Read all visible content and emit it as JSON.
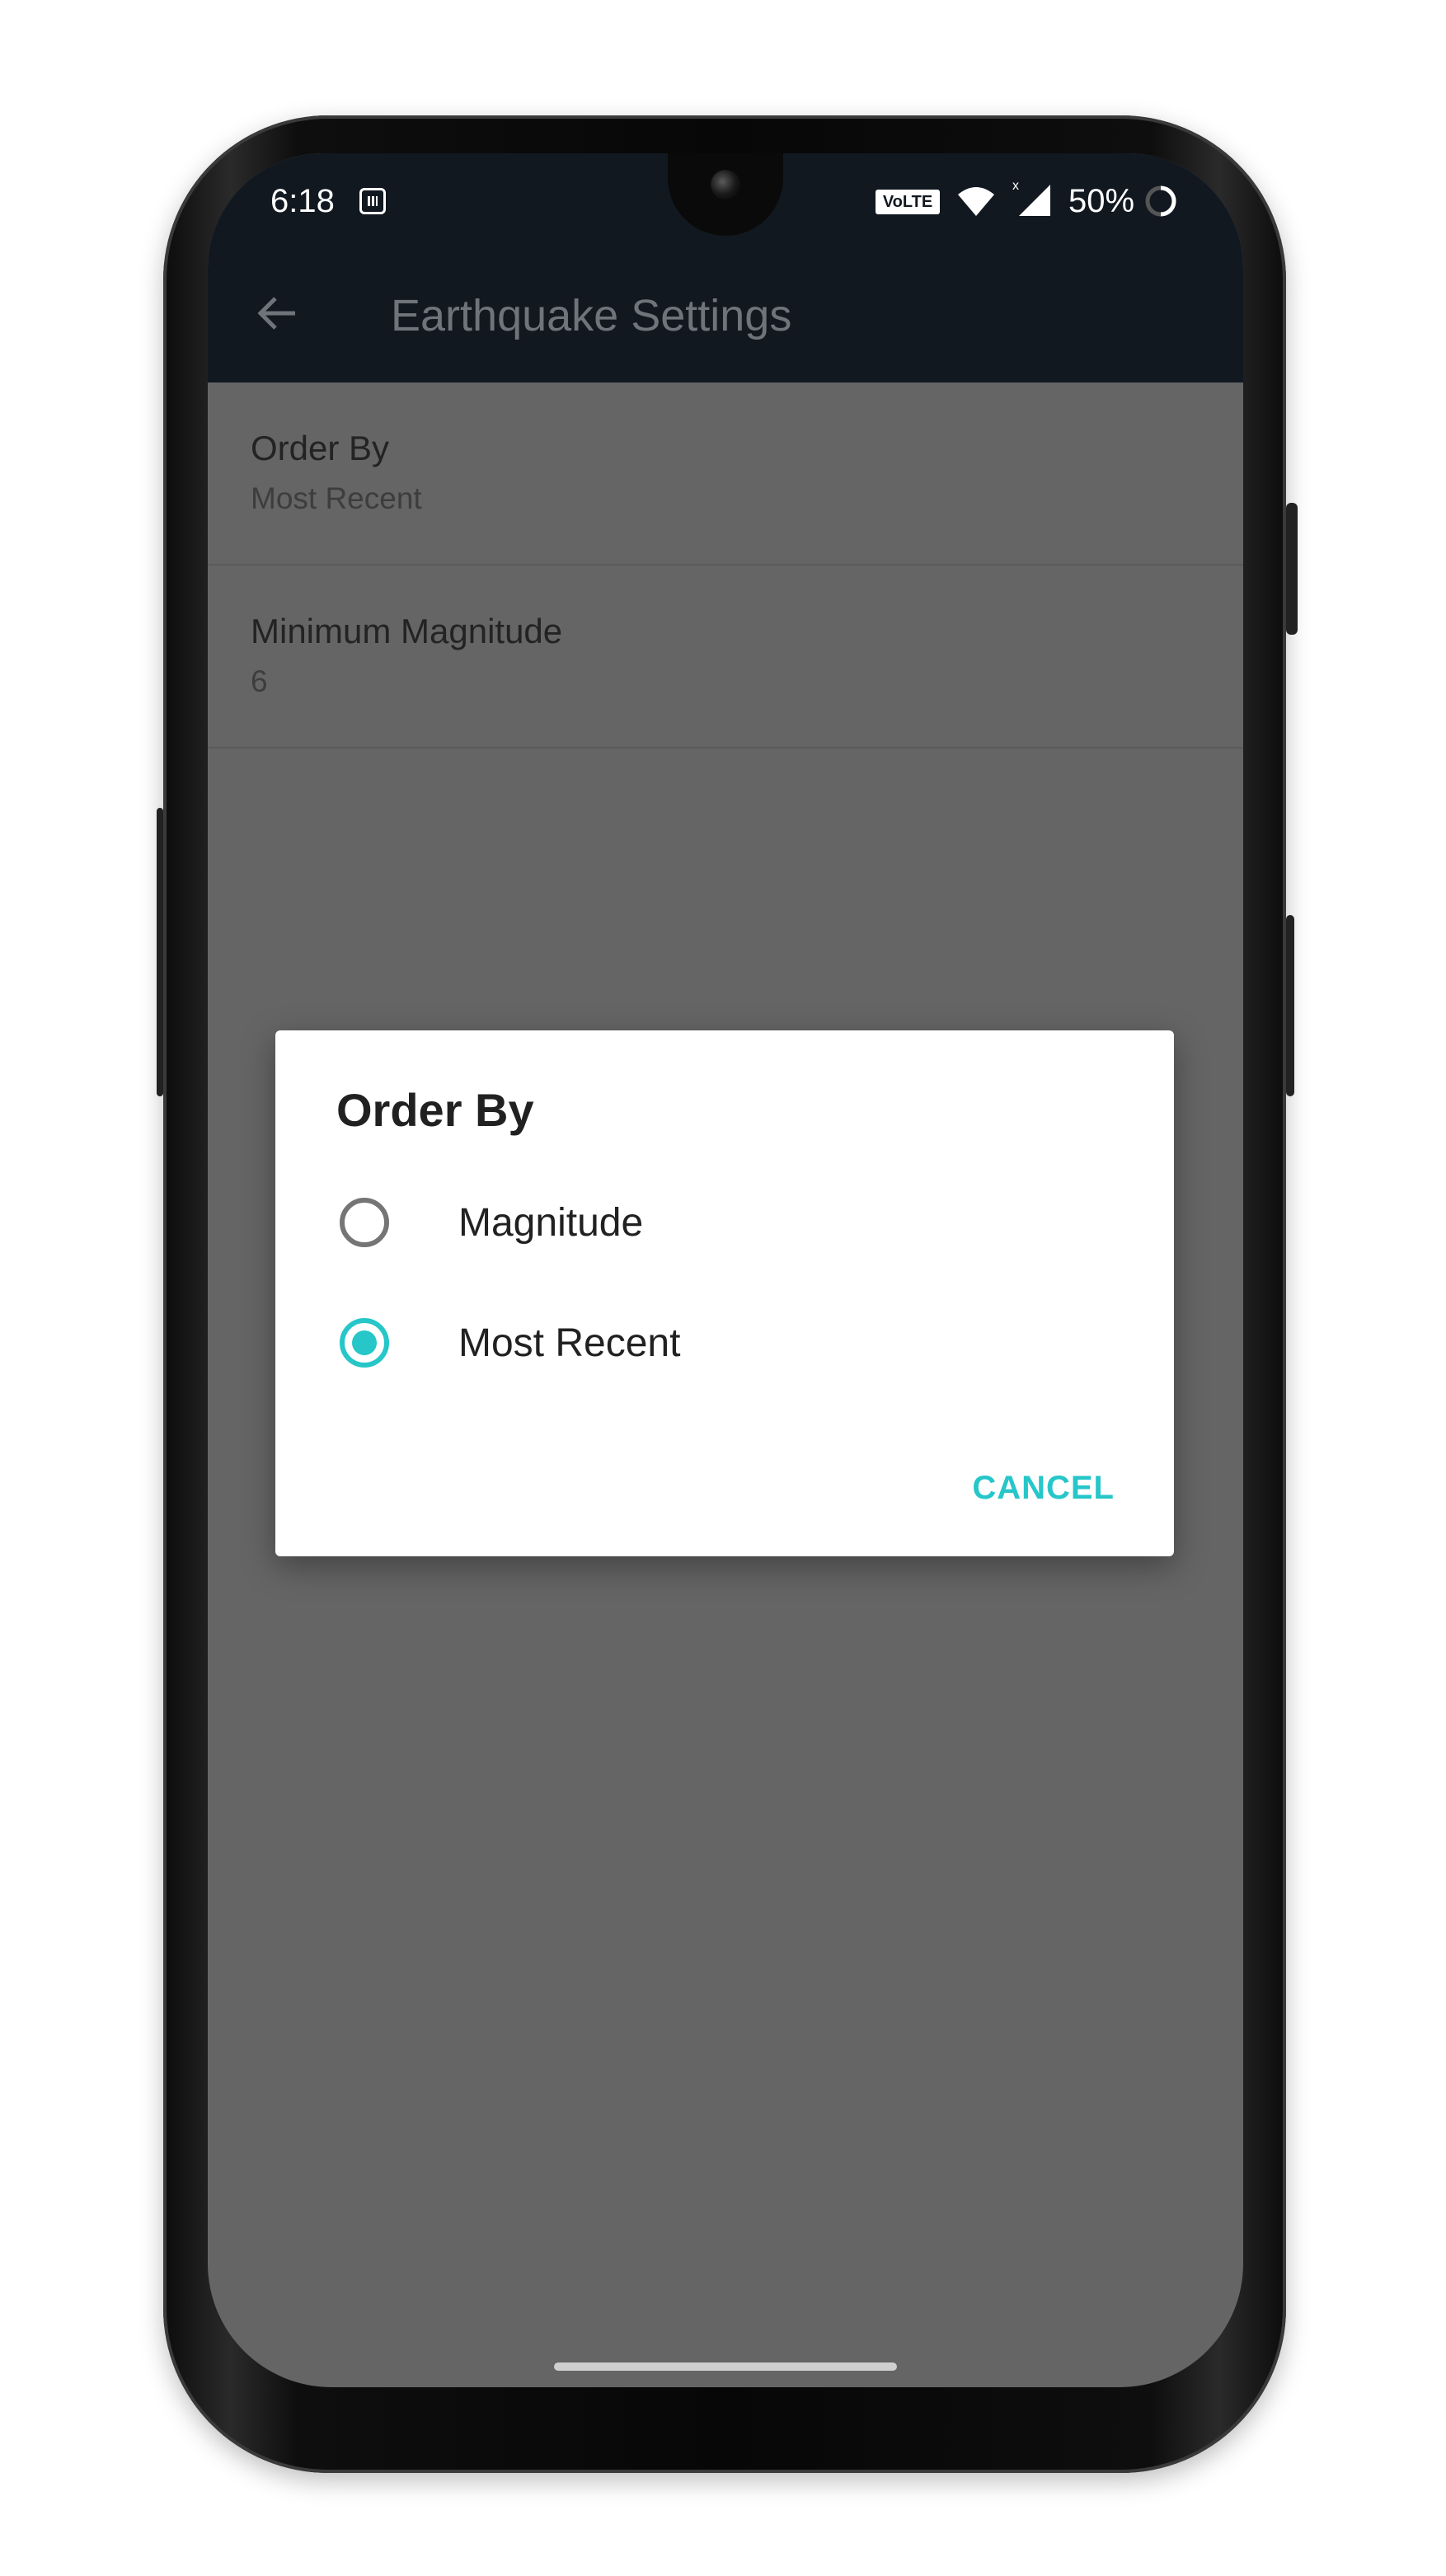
{
  "status_bar": {
    "time": "6:18",
    "volte_label": "VoLTE",
    "battery": "50%",
    "icons": [
      "sim-icon",
      "wifi-icon",
      "signal-icon",
      "battery-icon"
    ]
  },
  "toolbar": {
    "title": "Earthquake Settings",
    "back_icon": "arrow-left-icon"
  },
  "preferences": [
    {
      "title": "Order By",
      "summary": "Most Recent"
    },
    {
      "title": "Minimum Magnitude",
      "summary": "6"
    }
  ],
  "dialog": {
    "title": "Order By",
    "options": [
      {
        "label": "Magnitude",
        "selected": false
      },
      {
        "label": "Most Recent",
        "selected": true
      }
    ],
    "cancel_label": "CANCEL"
  },
  "colors": {
    "accent": "#26c6c9",
    "toolbar": "#121820",
    "scrim_background": "#656565"
  }
}
